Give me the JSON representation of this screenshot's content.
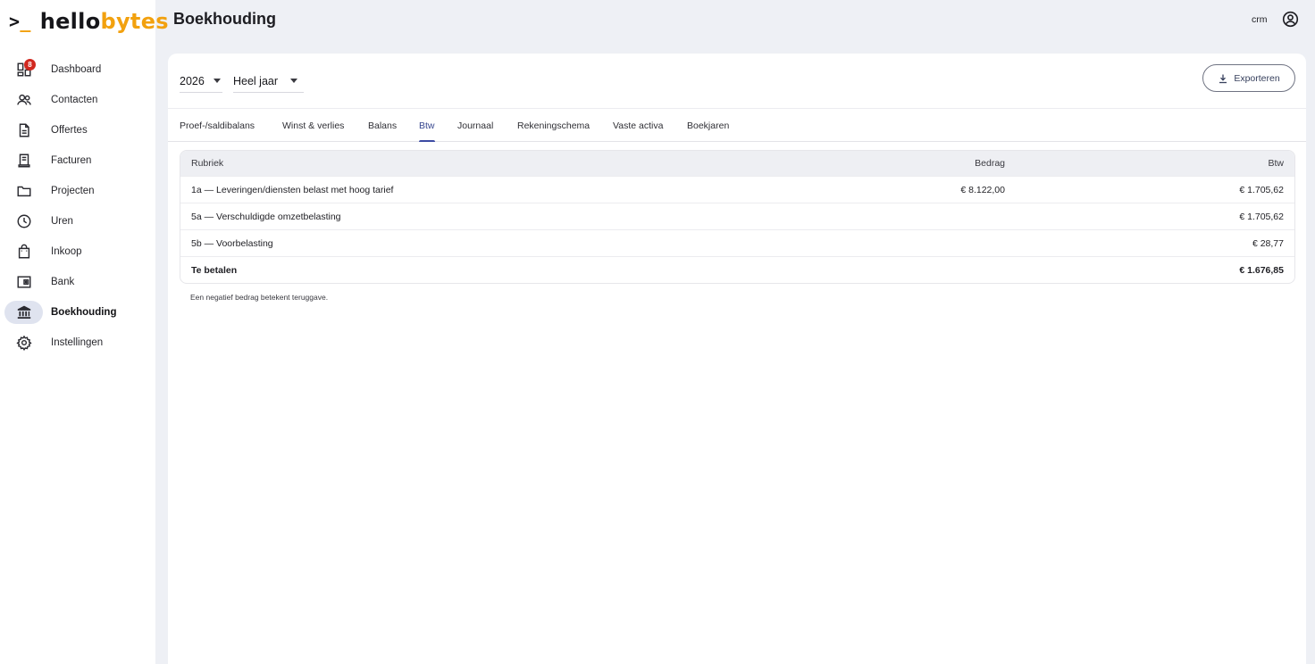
{
  "brand": {
    "prompt": ">",
    "underscore": "_",
    "hello": "hello",
    "bytes": "bytes",
    "accent_color": "#f2a10f"
  },
  "sidebar": {
    "items": [
      {
        "label": "Dashboard",
        "icon": "dashboard-icon",
        "badge": "8"
      },
      {
        "label": "Contacten",
        "icon": "people-icon"
      },
      {
        "label": "Offertes",
        "icon": "document-icon"
      },
      {
        "label": "Facturen",
        "icon": "receipt-icon"
      },
      {
        "label": "Projecten",
        "icon": "folder-icon"
      },
      {
        "label": "Uren",
        "icon": "clock-icon"
      },
      {
        "label": "Inkoop",
        "icon": "shopping-bag-icon"
      },
      {
        "label": "Bank",
        "icon": "wallet-icon"
      },
      {
        "label": "Boekhouding",
        "icon": "bank-icon",
        "active": true
      },
      {
        "label": "Instellingen",
        "icon": "gear-icon"
      }
    ],
    "badge_color": "#d1281f"
  },
  "header": {
    "title": "Boekhouding",
    "user": "crm"
  },
  "filters": {
    "year": "2026",
    "period": "Heel jaar"
  },
  "actions": {
    "export_label": "Exporteren"
  },
  "tabs": [
    {
      "label": "Proef-/saldibalans"
    },
    {
      "label": "Winst & verlies"
    },
    {
      "label": "Balans"
    },
    {
      "label": "Btw",
      "active": true
    },
    {
      "label": "Journaal"
    },
    {
      "label": "Rekeningschema"
    },
    {
      "label": "Vaste activa"
    },
    {
      "label": "Boekjaren"
    }
  ],
  "table": {
    "headers": {
      "rubriek": "Rubriek",
      "bedrag": "Bedrag",
      "btw": "Btw"
    },
    "rows": [
      {
        "rubriek": "1a — Leveringen/diensten belast met hoog tarief",
        "bedrag": "€ 8.122,00",
        "btw": "€ 1.705,62"
      },
      {
        "rubriek": "5a — Verschuldigde omzetbelasting",
        "bedrag": "",
        "btw": "€ 1.705,62"
      },
      {
        "rubriek": "5b — Voorbelasting",
        "bedrag": "",
        "btw": "€ 28,77"
      },
      {
        "rubriek": "Te betalen",
        "bedrag": "",
        "btw": "€ 1.676,85",
        "total": true
      }
    ],
    "note": "Een negatief bedrag betekent teruggave."
  },
  "colors": {
    "active_tab": "#3b4aa3",
    "page_bg": "#eef0f5",
    "nav_active_bg": "#dfe3ef"
  }
}
